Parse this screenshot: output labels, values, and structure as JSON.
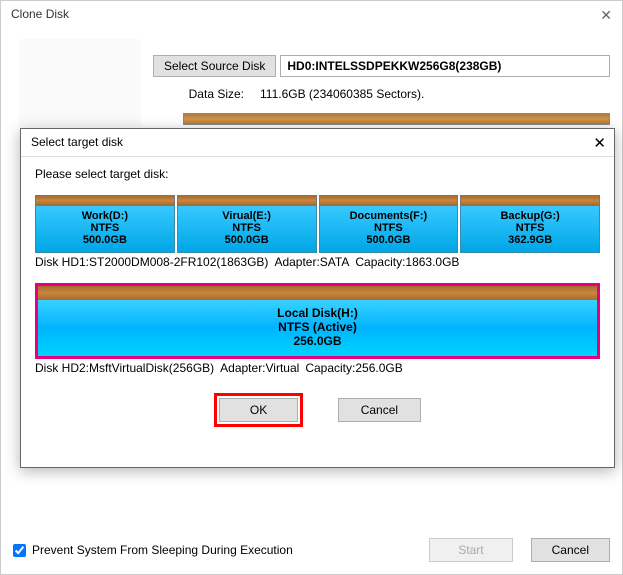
{
  "main": {
    "title": "Clone Disk",
    "select_source_label": "Select Source Disk",
    "source_disk": "HD0:INTELSSDPEKKW256G8(238GB)",
    "data_size_label": "Data Size:",
    "data_size_value": "111.6GB (234060385 Sectors).",
    "prevent_sleep_label": "Prevent System From Sleeping During Execution",
    "start_label": "Start",
    "cancel_label": "Cancel"
  },
  "modal": {
    "title": "Select target disk",
    "prompt": "Please select target disk:",
    "disk1": {
      "parts": [
        {
          "name": "Work(D:)",
          "fs": "NTFS",
          "size": "500.0GB"
        },
        {
          "name": "Virual(E:)",
          "fs": "NTFS",
          "size": "500.0GB"
        },
        {
          "name": "Documents(F:)",
          "fs": "NTFS",
          "size": "500.0GB"
        },
        {
          "name": "Backup(G:)",
          "fs": "NTFS",
          "size": "362.9GB"
        }
      ],
      "caption_disk": "Disk HD1:ST2000DM008-2FR102(1863GB)",
      "caption_adapter": "Adapter:SATA",
      "caption_capacity": "Capacity:1863.0GB"
    },
    "disk2": {
      "name": "Local Disk(H:)",
      "fs": "NTFS (Active)",
      "size": "256.0GB",
      "caption_disk": "Disk HD2:MsftVirtualDisk(256GB)",
      "caption_adapter": "Adapter:Virtual",
      "caption_capacity": "Capacity:256.0GB"
    },
    "ok_label": "OK",
    "cancel_label": "Cancel"
  }
}
